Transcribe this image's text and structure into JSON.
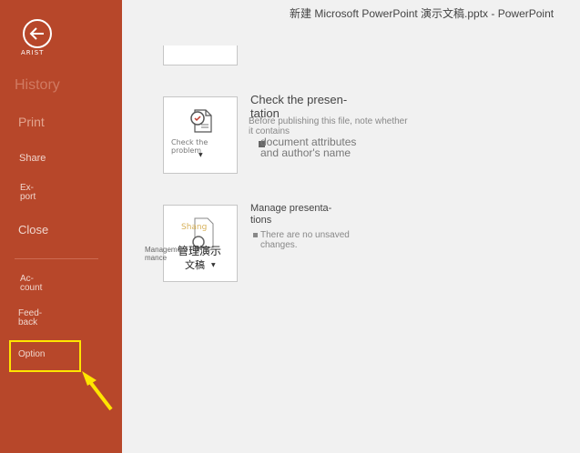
{
  "window": {
    "title": "新建 Microsoft PowerPoint 演示文稿.pptx  -  PowerPoint"
  },
  "sidebar": {
    "back_label": "ARIST",
    "items": [
      {
        "label": "History"
      },
      {
        "label": "Print"
      },
      {
        "label": "Share"
      },
      {
        "label": "Ex-\nport"
      },
      {
        "label": "Close"
      },
      {
        "label": "Ac-\ncount"
      },
      {
        "label": "Feed-\nback"
      },
      {
        "label": "Option"
      }
    ]
  },
  "check": {
    "button_label": "Check the problem",
    "heading": "Check the presen-\ntation",
    "desc": "Before publishing this file, note whether it contains",
    "bullet": "document attributes\nand author's name"
  },
  "manage": {
    "heading": "Manage presenta-\ntions",
    "bullet": "There are no unsaved\nchanges.",
    "button_label": "Management Perfor-\nmance",
    "button_cn1": "管理演示",
    "button_cn2": "文稿",
    "shang": "Shang"
  },
  "colors": {
    "sidebar": "#b7472a",
    "highlight": "#ffe500"
  }
}
